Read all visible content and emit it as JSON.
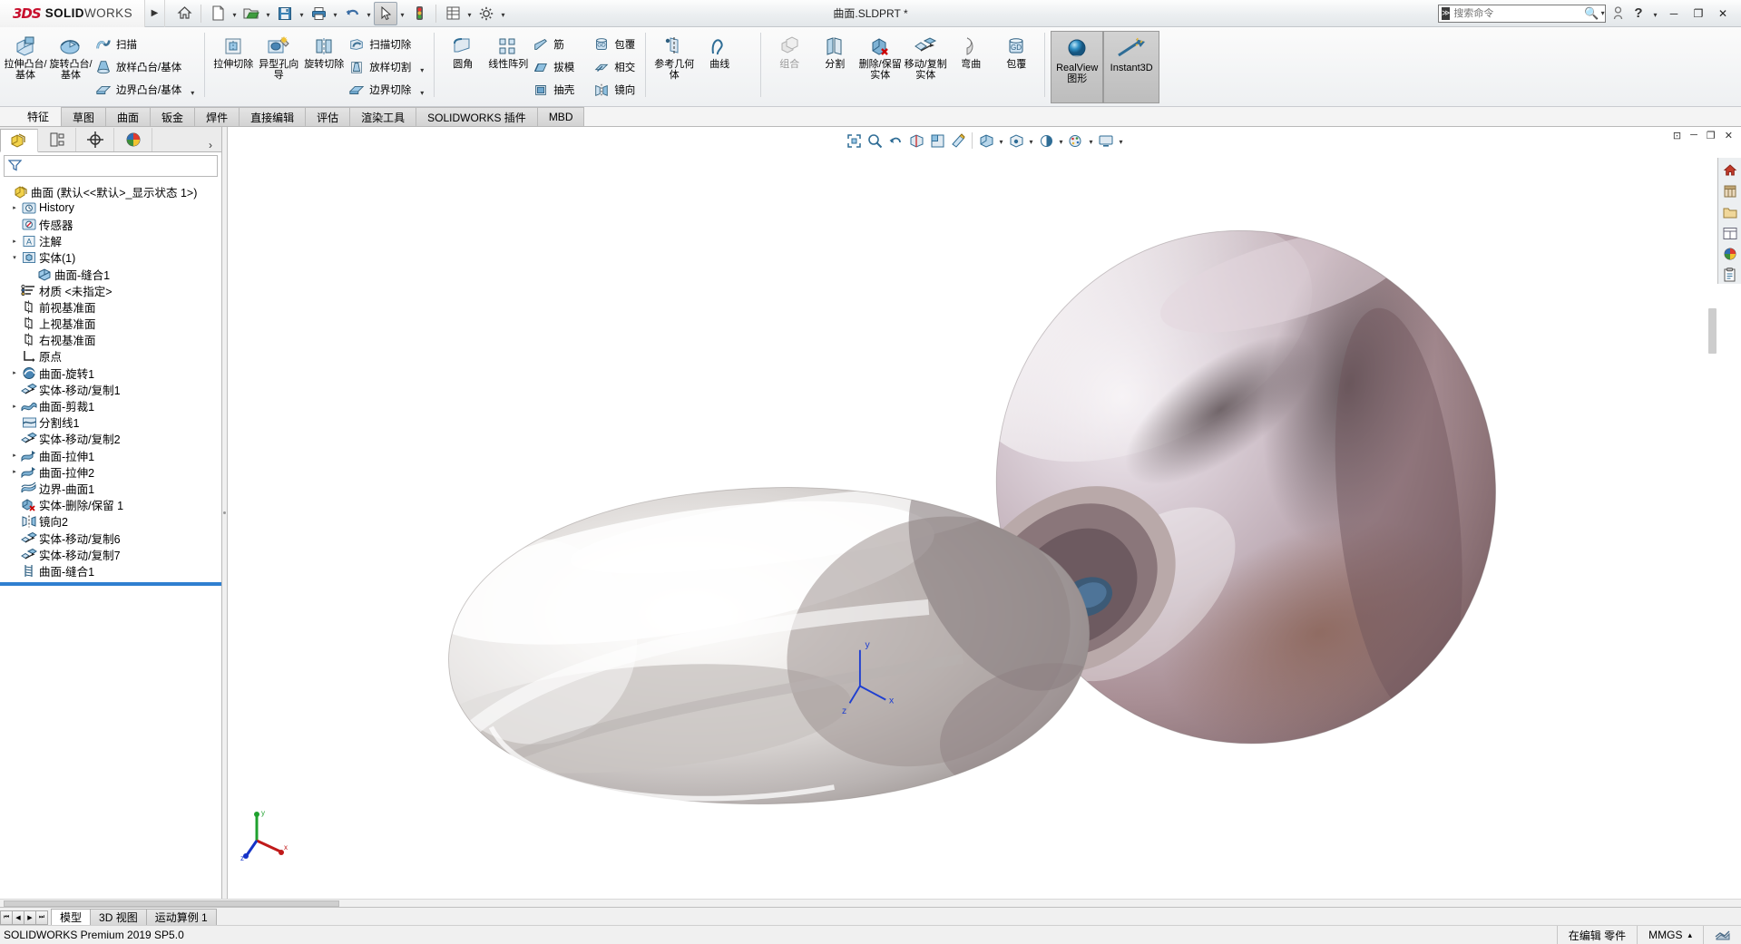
{
  "app": {
    "brand_ds": "3DS",
    "brand_solid": "SOLID",
    "brand_works": "WORKS",
    "document_title": "曲面.SLDPRT *",
    "accent_red": "#c8102e",
    "accent_blue": "#2f7fd0"
  },
  "titlebar": {
    "expand_arrow": "▶",
    "quick_access": [
      {
        "name": "home-icon",
        "glyph": "⌂",
        "label": "主页"
      },
      {
        "name": "new-doc-icon",
        "glyph": "🗋",
        "label": "新建"
      },
      {
        "name": "open-folder-icon",
        "glyph": "🖿",
        "label": "打开"
      },
      {
        "name": "save-icon",
        "glyph": "💾",
        "label": "保存"
      },
      {
        "name": "print-icon",
        "glyph": "🖶",
        "label": "打印"
      },
      {
        "name": "undo-icon",
        "glyph": "↺",
        "label": "撤销"
      },
      {
        "name": "select-cursor-icon",
        "glyph": "➤",
        "label": "选择"
      },
      {
        "name": "rebuild-icon",
        "glyph": "🚦",
        "label": "重建模型"
      },
      {
        "name": "options-grid-icon",
        "glyph": "▦",
        "label": "文件属性"
      },
      {
        "name": "settings-gear-icon",
        "glyph": "⚙",
        "label": "选项"
      }
    ],
    "search": {
      "placeholder": "搜索命令",
      "value": "",
      "icon": "search-icon"
    },
    "right_icons": [
      {
        "name": "user-account-icon",
        "glyph": "👤"
      },
      {
        "name": "help-icon",
        "glyph": "?"
      }
    ],
    "window_buttons": [
      {
        "name": "minimize-button",
        "glyph": "─"
      },
      {
        "name": "restore-button",
        "glyph": "❐"
      },
      {
        "name": "close-button",
        "glyph": "✕"
      }
    ]
  },
  "ribbon": {
    "groups": [
      {
        "name": "features-group",
        "big": [
          {
            "label": "拉伸凸台/基体",
            "icon": "extrude-boss-icon"
          },
          {
            "label": "旋转凸台/基体",
            "icon": "revolve-boss-icon"
          }
        ],
        "small": [
          {
            "label": "扫描",
            "icon": "sweep-icon"
          },
          {
            "label": "放样凸台/基体",
            "icon": "loft-boss-icon"
          },
          {
            "label": "边界凸台/基体",
            "icon": "boundary-boss-icon"
          }
        ]
      },
      {
        "name": "cut-group",
        "big": [
          {
            "label": "拉伸切除",
            "icon": "extrude-cut-icon"
          },
          {
            "label": "异型孔向导",
            "icon": "hole-wizard-icon"
          },
          {
            "label": "旋转切除",
            "icon": "revolve-cut-icon"
          }
        ],
        "small": [
          {
            "label": "扫描切除",
            "icon": "sweep-cut-icon"
          },
          {
            "label": "放样切割",
            "icon": "loft-cut-icon"
          },
          {
            "label": "边界切除",
            "icon": "boundary-cut-icon"
          }
        ]
      },
      {
        "name": "modify-group",
        "big": [
          {
            "label": "圆角",
            "icon": "fillet-icon"
          },
          {
            "label": "线性阵列",
            "icon": "linear-pattern-icon"
          }
        ],
        "small": [
          {
            "label": "筋",
            "icon": "rib-icon"
          },
          {
            "label": "拔模",
            "icon": "draft-icon"
          },
          {
            "label": "抽壳",
            "icon": "shell-icon"
          },
          {
            "label": "镜向",
            "icon": "mirror-icon"
          },
          {
            "label": "包覆",
            "icon": "wrap-icon"
          },
          {
            "label": "相交",
            "icon": "intersect-icon"
          }
        ]
      },
      {
        "name": "reference-group",
        "big": [
          {
            "label": "参考几何体",
            "icon": "reference-geometry-icon"
          },
          {
            "label": "曲线",
            "icon": "curve-icon"
          }
        ],
        "small": []
      },
      {
        "name": "bodies-group",
        "big": [
          {
            "label": "组合",
            "icon": "combine-icon",
            "disabled": true
          },
          {
            "label": "分割",
            "icon": "split-icon"
          },
          {
            "label": "删除/保留实体",
            "icon": "delete-keep-body-icon"
          },
          {
            "label": "移动/复制实体",
            "icon": "move-copy-body-icon"
          },
          {
            "label": "弯曲",
            "icon": "flex-icon"
          },
          {
            "label": "包覆",
            "icon": "wrap2-icon"
          }
        ],
        "small": []
      },
      {
        "name": "display-group",
        "toggles": [
          {
            "label": "RealView 图形",
            "icon": "realview-icon",
            "active": true
          },
          {
            "label": "Instant3D",
            "icon": "instant3d-icon",
            "active": true
          }
        ]
      }
    ]
  },
  "command_tabs": {
    "first": "特征",
    "items": [
      {
        "label": "草图"
      },
      {
        "label": "曲面"
      },
      {
        "label": "钣金"
      },
      {
        "label": "焊件"
      },
      {
        "label": "直接编辑"
      },
      {
        "label": "评估"
      },
      {
        "label": "渲染工具"
      },
      {
        "label": "SOLIDWORKS 插件"
      },
      {
        "label": "MBD"
      }
    ],
    "active": "特征"
  },
  "left_panel": {
    "tabs": [
      {
        "name": "feature-manager-tab",
        "icon": "feature-tree-icon",
        "active": true
      },
      {
        "name": "property-manager-tab",
        "icon": "property-manager-icon",
        "active": false
      },
      {
        "name": "configuration-manager-tab",
        "icon": "configuration-icon",
        "active": false
      },
      {
        "name": "display-manager-tab",
        "icon": "appearance-icon",
        "active": false
      }
    ],
    "more_glyph": "›",
    "filter": {
      "placeholder": "",
      "value": "",
      "icon": "filter-funnel-icon"
    },
    "tree": [
      {
        "label": "曲面  (默认<<默认>_显示状态 1>)",
        "icon": "part-icon",
        "indent": 0,
        "expander": ""
      },
      {
        "label": "History",
        "icon": "history-icon",
        "indent": 1,
        "expander": "▸"
      },
      {
        "label": "传感器",
        "icon": "sensor-icon",
        "indent": 1,
        "expander": ""
      },
      {
        "label": "注解",
        "icon": "annotation-icon",
        "indent": 1,
        "expander": "▸"
      },
      {
        "label": "实体(1)",
        "icon": "solid-bodies-icon",
        "indent": 1,
        "expander": "▾"
      },
      {
        "label": "曲面-缝合1",
        "icon": "body-icon",
        "indent": 2,
        "expander": ""
      },
      {
        "label": "材质 <未指定>",
        "icon": "material-icon",
        "indent": 1,
        "expander": ""
      },
      {
        "label": "前视基准面",
        "icon": "plane-icon",
        "indent": 1,
        "expander": ""
      },
      {
        "label": "上视基准面",
        "icon": "plane-icon",
        "indent": 1,
        "expander": ""
      },
      {
        "label": "右视基准面",
        "icon": "plane-icon",
        "indent": 1,
        "expander": ""
      },
      {
        "label": "原点",
        "icon": "origin-icon",
        "indent": 1,
        "expander": ""
      },
      {
        "label": "曲面-旋转1",
        "icon": "surface-revolve-icon",
        "indent": 1,
        "expander": "▸"
      },
      {
        "label": "实体-移动/复制1",
        "icon": "move-copy-icon",
        "indent": 1,
        "expander": ""
      },
      {
        "label": "曲面-剪裁1",
        "icon": "surface-trim-icon",
        "indent": 1,
        "expander": "▸"
      },
      {
        "label": "分割线1",
        "icon": "split-line-icon",
        "indent": 1,
        "expander": ""
      },
      {
        "label": "实体-移动/复制2",
        "icon": "move-copy-icon",
        "indent": 1,
        "expander": ""
      },
      {
        "label": "曲面-拉伸1",
        "icon": "surface-extrude-icon",
        "indent": 1,
        "expander": "▸"
      },
      {
        "label": "曲面-拉伸2",
        "icon": "surface-extrude-icon",
        "indent": 1,
        "expander": "▸"
      },
      {
        "label": "边界-曲面1",
        "icon": "boundary-surface-icon",
        "indent": 1,
        "expander": ""
      },
      {
        "label": "实体-删除/保留 1",
        "icon": "delete-body-icon",
        "indent": 1,
        "expander": ""
      },
      {
        "label": "镜向2",
        "icon": "mirror-feature-icon",
        "indent": 1,
        "expander": ""
      },
      {
        "label": "实体-移动/复制6",
        "icon": "move-copy-icon",
        "indent": 1,
        "expander": ""
      },
      {
        "label": "实体-移动/复制7",
        "icon": "move-copy-icon",
        "indent": 1,
        "expander": ""
      },
      {
        "label": "曲面-缝合1",
        "icon": "surface-knit-icon",
        "indent": 1,
        "expander": ""
      }
    ],
    "rollback_bar": true
  },
  "graphics_toolbar": {
    "items": [
      {
        "name": "zoom-to-fit-icon",
        "glyph": "⤢"
      },
      {
        "name": "zoom-to-area-icon",
        "glyph": "🔍"
      },
      {
        "name": "previous-view-icon",
        "glyph": "↩"
      },
      {
        "name": "section-view-icon",
        "glyph": "◱"
      },
      {
        "name": "view-orientation-icon",
        "glyph": "◧"
      },
      {
        "name": "3d-drawing-view-icon",
        "glyph": "✎"
      },
      {
        "name": "display-style-icon",
        "glyph": "▣",
        "caret": true
      },
      {
        "name": "hide-show-icon",
        "glyph": "👁",
        "caret": true
      },
      {
        "name": "edit-appearance-icon",
        "glyph": "◐"
      },
      {
        "name": "apply-scene-icon",
        "glyph": "🎨",
        "caret": true
      },
      {
        "name": "view-settings-icon",
        "glyph": "🖵",
        "caret": true
      }
    ]
  },
  "graphics_window_buttons": [
    {
      "name": "restore-doc-button",
      "glyph": "⊡"
    },
    {
      "name": "minimize-doc-button",
      "glyph": "─"
    },
    {
      "name": "maximize-doc-button",
      "glyph": "❐"
    },
    {
      "name": "close-doc-button",
      "glyph": "✕"
    }
  ],
  "right_dock": [
    {
      "name": "design-library-home-icon",
      "glyph": "⌂"
    },
    {
      "name": "design-library-icon",
      "glyph": "▤"
    },
    {
      "name": "file-explorer-icon",
      "glyph": "🗀"
    },
    {
      "name": "view-palette-icon",
      "glyph": "▦"
    },
    {
      "name": "appearances-scenes-icon",
      "glyph": "◕"
    },
    {
      "name": "custom-properties-icon",
      "glyph": "📋"
    }
  ],
  "triad": {
    "x_label": "x",
    "y_label": "y",
    "z_label": "z"
  },
  "bottom_tabs": {
    "nav": [
      "⏮",
      "◀",
      "▶",
      "⏭"
    ],
    "items": [
      {
        "label": "模型",
        "active": true
      },
      {
        "label": "3D 视图",
        "active": false
      },
      {
        "label": "运动算例 1",
        "active": false
      }
    ]
  },
  "statusbar": {
    "version": "SOLIDWORKS Premium 2019 SP5.0",
    "edit_state": "在编辑 零件",
    "units": "MMGS",
    "units_caret": "▴",
    "overlay_icon": "options-icon"
  }
}
